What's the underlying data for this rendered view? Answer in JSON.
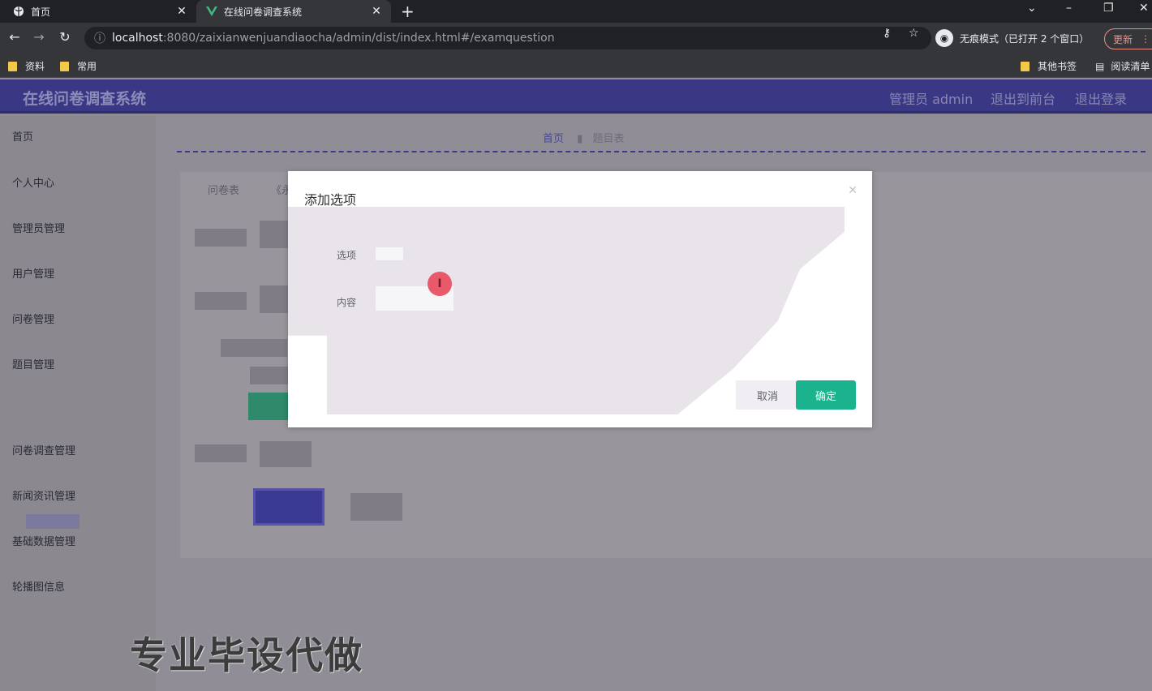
{
  "browser": {
    "tabs": [
      {
        "title": "首页",
        "icon": "globe-icon"
      },
      {
        "title": "在线问卷调查系统",
        "icon": "vue-icon"
      }
    ],
    "url_host": "localhost",
    "url_rest": ":8080/zaixianwenjuandiaocha/admin/dist/index.html#/examquestion",
    "incognito_label": "无痕模式（已打开 2 个窗口）",
    "update_label": "更新",
    "bookmarks": [
      "资料",
      "常用"
    ],
    "bookmarks_right": [
      "其他书签",
      "阅读清单"
    ]
  },
  "header": {
    "title": "在线问卷调查系统",
    "user": "管理员 admin",
    "to_front": "退出到前台",
    "logout": "退出登录"
  },
  "sidebar": {
    "items": [
      "首页",
      "个人中心",
      "管理员管理",
      "用户管理",
      "问卷管理",
      "题目管理",
      "问卷调查管理",
      "新闻资讯管理",
      "基础数据管理",
      "轮播图信息"
    ]
  },
  "breadcrumb": {
    "home": "首页",
    "current": "题目表"
  },
  "panel": {
    "col1": "问卷表",
    "col2": "《永"
  },
  "dialog": {
    "title": "添加选项",
    "label_option": "选项",
    "label_content": "内容",
    "cancel": "取消",
    "confirm": "确定"
  },
  "watermark": "专业毕设代做",
  "colors": {
    "header": "#3a3785",
    "confirm": "#1bb38e",
    "dialog_bg": "#ffffff"
  }
}
